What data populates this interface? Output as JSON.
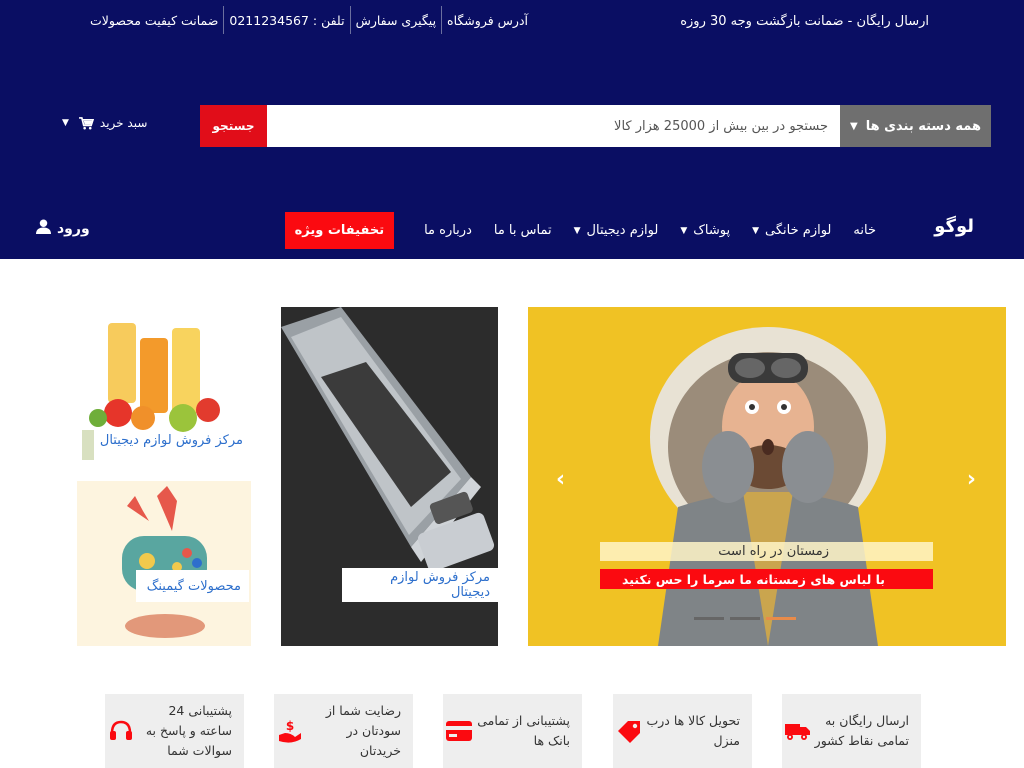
{
  "topbar": {
    "promo": "ارسال رایگان - ضمانت بازگشت وجه 30 روزه",
    "links": [
      {
        "label": "آدرس فروشگاه"
      },
      {
        "label": "پیگیری سفارش"
      },
      {
        "label": "تلفن : 0211234567"
      },
      {
        "label": "ضمانت کیفیت محصولات"
      }
    ]
  },
  "search": {
    "category_label": "همه دسته بندی ها",
    "placeholder": "جستجو در بین بیش از 25000 هزار کالا",
    "button_label": "جستجو"
  },
  "cart": {
    "label": "سبد خرید"
  },
  "header": {
    "logo": "لوگو",
    "login_label": "ورود"
  },
  "nav": {
    "items": [
      {
        "label": "خانه",
        "dropdown": false
      },
      {
        "label": "لوازم خانگی",
        "dropdown": true
      },
      {
        "label": "پوشاک",
        "dropdown": true
      },
      {
        "label": "لوازم دیجیتال",
        "dropdown": true
      },
      {
        "label": "تماس با ما",
        "dropdown": false
      },
      {
        "label": "درباره ما",
        "dropdown": false
      }
    ],
    "special_label": "تخفیفات ویژه"
  },
  "slider": {
    "caption_title": "زمستان در راه است",
    "caption_text": "با لباس های زمستانه ما سرما را حس نکنید",
    "slide_count": 3,
    "active_slide": 1
  },
  "banners": {
    "laptop_label": "مرکز فروش لوازم دیجیتال",
    "juice_label": "مرکز فروش لوازم دیجیتال",
    "gaming_label": "محصولات گیمینگ"
  },
  "features": [
    {
      "text": "ارسال رایگان به تمامی نقاط کشور",
      "icon": "truck-icon"
    },
    {
      "text": "تحویل کالا ها درب منزل",
      "icon": "tag-icon"
    },
    {
      "text": "پشتیبانی از تمامی بانک ها",
      "icon": "credit-card-icon"
    },
    {
      "text": "رضایت شما از سودتان در خریدتان",
      "icon": "hand-money-icon"
    },
    {
      "text": "پشتیبانی 24 ساعته و پاسخ به سوالات شما",
      "icon": "headset-icon"
    }
  ],
  "colors": {
    "header_bg": "#0a0e63",
    "accent_red": "#fb0a10",
    "link_blue": "#2d6fcc",
    "slider_bg": "#f0c224"
  }
}
